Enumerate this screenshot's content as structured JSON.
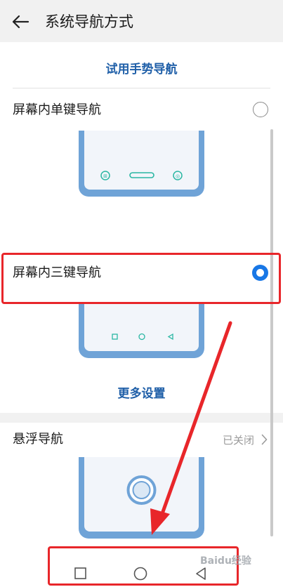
{
  "header": {
    "title": "系统导航方式"
  },
  "gesture_link": "试用手势导航",
  "options": [
    {
      "label": "屏幕内单键导航",
      "selected": false
    },
    {
      "label": "屏幕内三键导航",
      "selected": true
    }
  ],
  "more_settings": "更多设置",
  "floating_nav": {
    "label": "悬浮导航",
    "status": "已关闭"
  },
  "system_nav_bar": {
    "buttons": [
      "square-icon",
      "circle-icon",
      "triangle-back-icon"
    ]
  },
  "colors": {
    "accent": "#1877e6",
    "link": "#1f5fa8",
    "highlight": "#e8262a",
    "phone": "#6fa3d7"
  },
  "watermark": "Baidu经验"
}
